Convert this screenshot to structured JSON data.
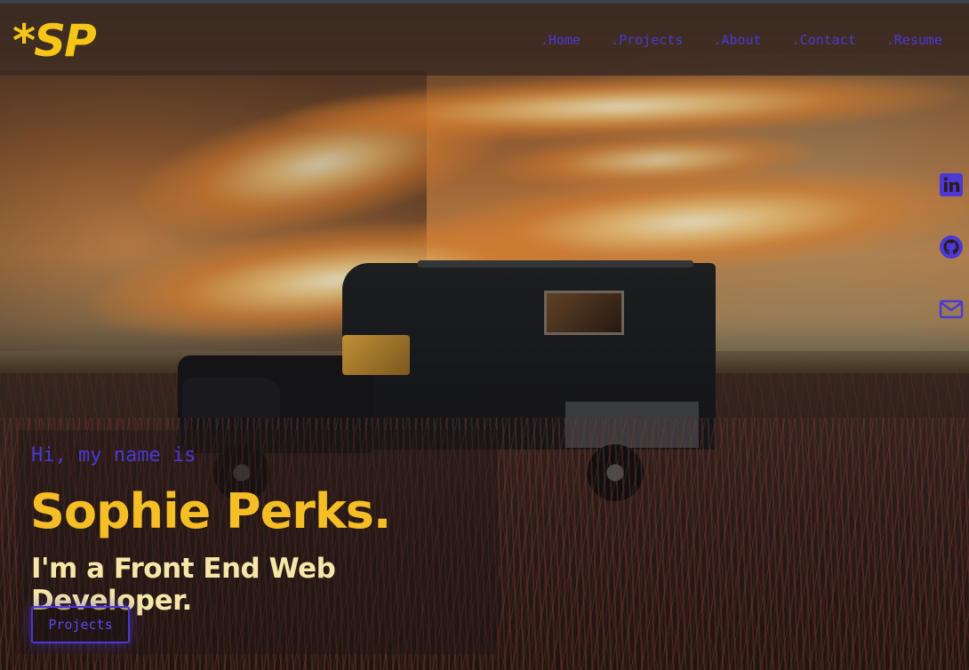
{
  "brand": {
    "logo_text": "*SP"
  },
  "nav": {
    "items": [
      {
        "label": ".Home"
      },
      {
        "label": ".Projects"
      },
      {
        "label": ".About"
      },
      {
        "label": ".Contact"
      },
      {
        "label": ".Resume"
      }
    ]
  },
  "social": {
    "icons": [
      "linkedin-icon",
      "github-icon",
      "mail-icon"
    ]
  },
  "hero": {
    "greeting": "Hi, my name is",
    "name": "Sophie Perks.",
    "role": "I'm a Front End Web Developer.",
    "cta_label": "Projects"
  },
  "colors": {
    "accent": "#4b38d6",
    "brand_yellow": "#f5be25",
    "role_text": "#f6e7a8"
  }
}
